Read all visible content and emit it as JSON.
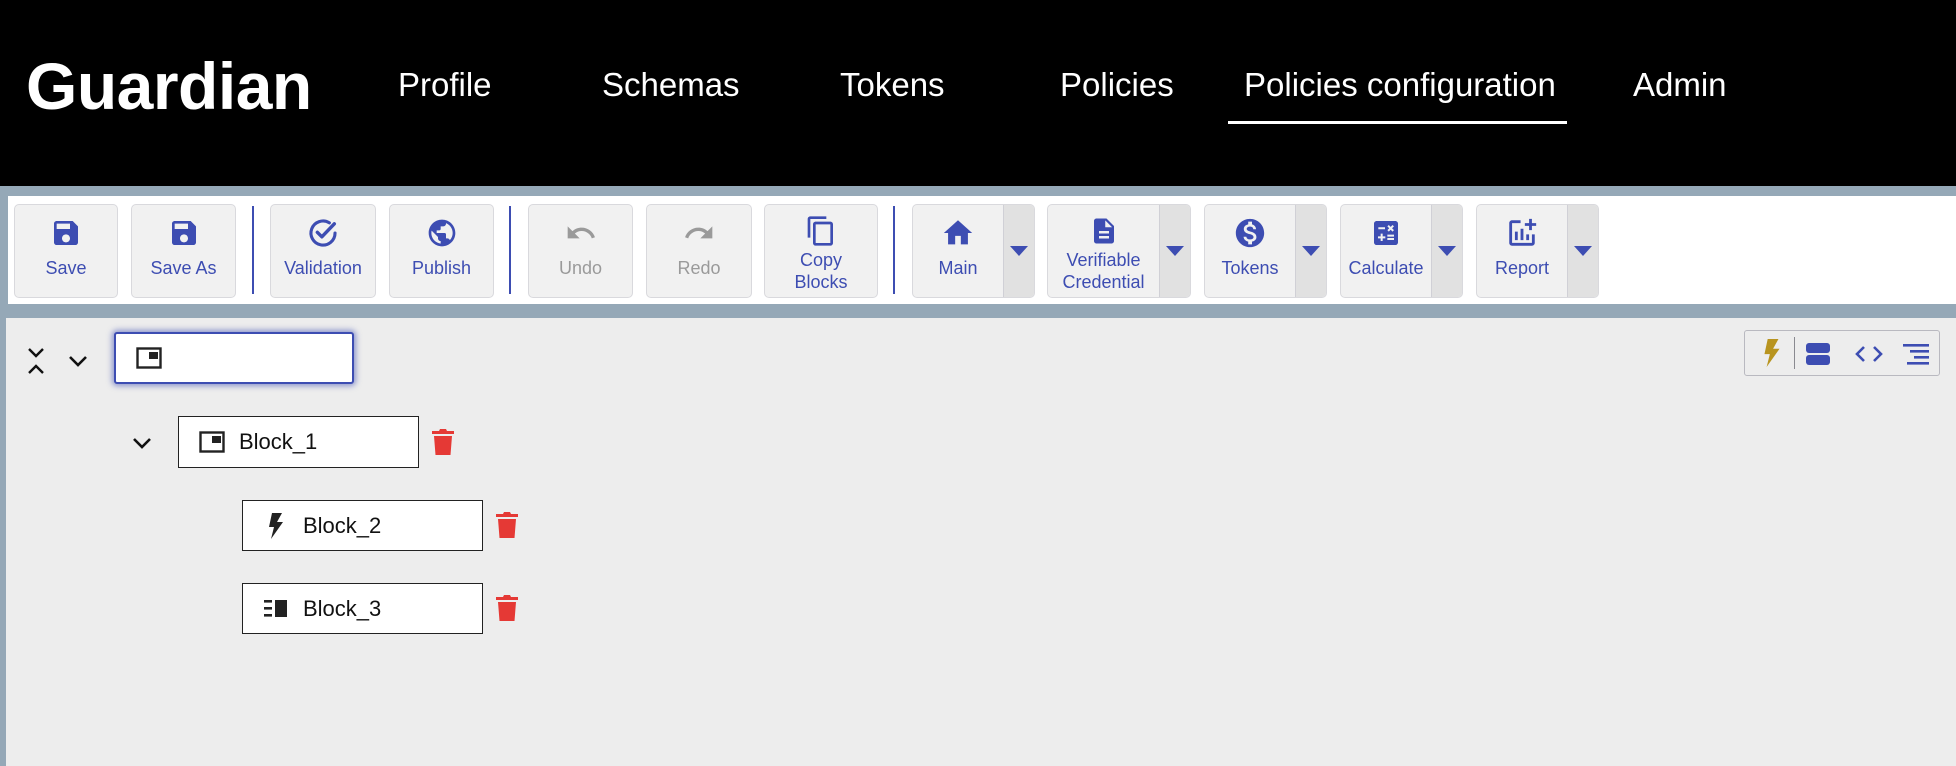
{
  "header": {
    "logo": "Guardian",
    "nav": [
      {
        "label": "Profile"
      },
      {
        "label": "Schemas"
      },
      {
        "label": "Tokens"
      },
      {
        "label": "Policies"
      },
      {
        "label": "Policies configuration",
        "active": true
      },
      {
        "label": "Admin"
      }
    ]
  },
  "toolbar": {
    "save": "Save",
    "save_as": "Save As",
    "validation": "Validation",
    "publish": "Publish",
    "undo": "Undo",
    "redo": "Redo",
    "copy_blocks_1": "Copy",
    "copy_blocks_2": "Blocks",
    "main": "Main",
    "vc_1": "Verifiable",
    "vc_2": "Credential",
    "tokens": "Tokens",
    "calculate": "Calculate",
    "report": "Report"
  },
  "tree": {
    "root": {
      "label": "",
      "icon": "container-icon"
    },
    "blocks": [
      {
        "label": "Block_1",
        "icon": "container-icon"
      },
      {
        "label": "Block_2",
        "icon": "lightning-icon"
      },
      {
        "label": "Block_3",
        "icon": "list-icon"
      }
    ]
  },
  "colors": {
    "accent": "#3d4db2",
    "delete": "#e53935",
    "event": "#b8941f",
    "header_bg": "#000000"
  }
}
